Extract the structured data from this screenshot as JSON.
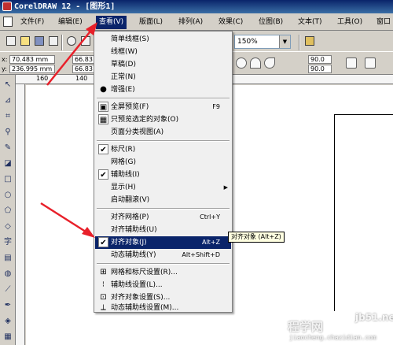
{
  "titlebar": {
    "text": "CorelDRAW 12 - [图形1]"
  },
  "menubar": {
    "items": [
      {
        "label": "文件(F)"
      },
      {
        "label": "编辑(E)"
      },
      {
        "label": "查看(V)"
      },
      {
        "label": "版面(L)"
      },
      {
        "label": "排列(A)"
      },
      {
        "label": "效果(C)"
      },
      {
        "label": "位图(B)"
      },
      {
        "label": "文本(T)"
      },
      {
        "label": "工具(O)"
      },
      {
        "label": "窗口"
      }
    ]
  },
  "toolbar": {
    "zoom_value": "150%"
  },
  "propertybar": {
    "x_label": "x:",
    "x_value": "70.483 mm",
    "y_label": "y:",
    "y_value": "236.995 mm",
    "w_value": "66.83",
    "h_value": "66.83",
    "angle1": "90.0",
    "angle2": "90.0"
  },
  "ruler": {
    "ticks": [
      "160",
      "140"
    ]
  },
  "view_menu": {
    "items": [
      {
        "label": "简单线框(S)",
        "mark": ""
      },
      {
        "label": "线框(W)",
        "mark": ""
      },
      {
        "label": "草稿(D)",
        "mark": ""
      },
      {
        "label": "正常(N)",
        "mark": ""
      },
      {
        "label": "增强(E)",
        "mark": "radio"
      },
      {
        "label": "全屏预览(F)",
        "shortcut": "F9",
        "mark": "icon"
      },
      {
        "label": "只预览选定的对象(O)",
        "mark": "icon"
      },
      {
        "label": "页面分类视图(A)",
        "mark": ""
      },
      {
        "label": "标尺(R)",
        "mark": "check"
      },
      {
        "label": "网格(G)",
        "mark": ""
      },
      {
        "label": "辅助线(I)",
        "mark": "check"
      },
      {
        "label": "显示(H)",
        "mark": "",
        "submenu": true
      },
      {
        "label": "启动翻滚(V)",
        "mark": ""
      },
      {
        "label": "对齐网格(P)",
        "shortcut": "Ctrl+Y",
        "mark": ""
      },
      {
        "label": "对齐辅助线(U)",
        "mark": ""
      },
      {
        "label": "对齐对象(J)",
        "shortcut": "Alt+Z",
        "mark": "check",
        "highlighted": true
      },
      {
        "label": "动态辅助线(Y)",
        "shortcut": "Alt+Shift+D",
        "mark": ""
      },
      {
        "label": "网格和标尺设置(R)...",
        "mark": "icon"
      },
      {
        "label": "辅助线设置(L)...",
        "mark": "icon"
      },
      {
        "label": "对齐对象设置(S)...",
        "mark": "icon"
      },
      {
        "label": "动态辅助线设置(M)...",
        "mark": "icon"
      }
    ]
  },
  "tooltip": {
    "text": "对齐对象 (Alt+Z)"
  },
  "watermark": {
    "main": "程学网",
    "site": "jb51.net",
    "url": "jiaocheng.chazidian.com"
  },
  "colors": {
    "title_bar": "#0a246a",
    "highlight": "#0a246a",
    "annotation_arrow": "#e8202a"
  }
}
